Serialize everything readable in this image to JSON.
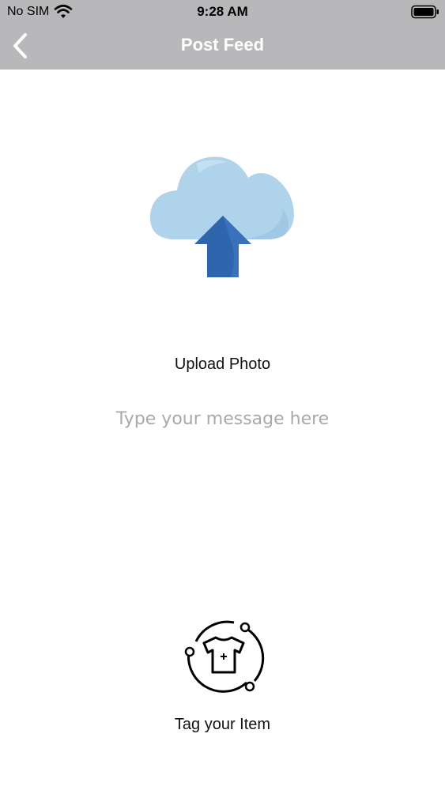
{
  "status_bar": {
    "carrier": "No SIM",
    "time": "9:28 AM",
    "icons": [
      "wifi-icon",
      "battery-icon"
    ]
  },
  "nav": {
    "title": "Post Feed",
    "back_icon": "chevron-left-icon",
    "background": "#b8b7ba"
  },
  "upload": {
    "icon": "cloud-upload-icon",
    "label": "Upload Photo",
    "colors": {
      "cloud": "#aed3ea",
      "arrow": "#2f65ad"
    }
  },
  "message": {
    "placeholder": "Type your message here",
    "value": ""
  },
  "tag": {
    "icon": "tshirt-tag-icon",
    "label": "Tag your Item"
  }
}
